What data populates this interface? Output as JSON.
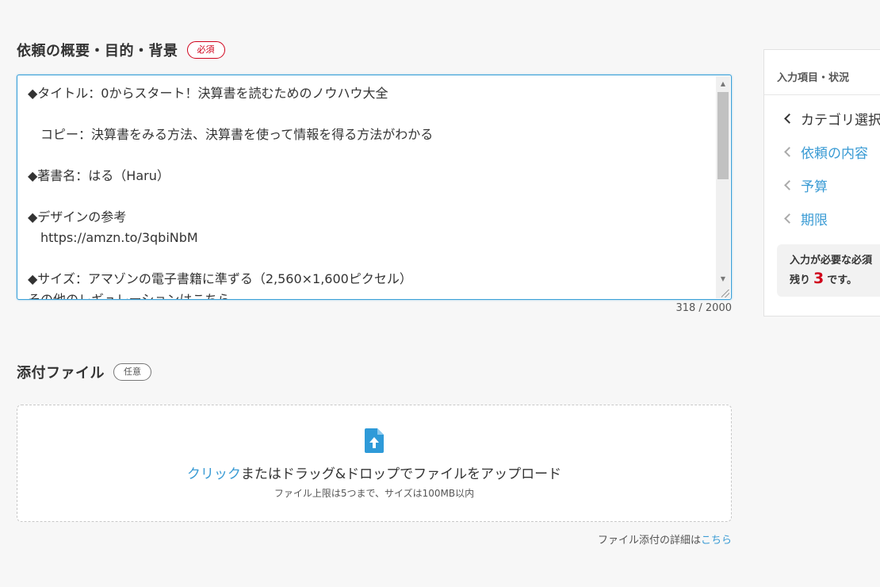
{
  "request_section": {
    "heading": "依頼の概要・目的・背景",
    "badge": "必須",
    "textarea_lines": [
      {
        "text": "◆タイトル：0からスタート！決算書を読むためのノウハウ大全",
        "indent": false
      },
      {
        "text": "",
        "indent": false
      },
      {
        "text": "コピー：決算書をみる方法、決算書を使って情報を得る方法がわかる",
        "indent": true
      },
      {
        "text": "",
        "indent": false
      },
      {
        "text": "◆著書名：はる（Haru）",
        "indent": false
      },
      {
        "text": "",
        "indent": false
      },
      {
        "text": "◆デザインの参考",
        "indent": false
      },
      {
        "text": "https://amzn.to/3qbiNbM",
        "indent": true
      },
      {
        "text": "",
        "indent": false
      },
      {
        "text": "◆サイズ：アマゾンの電子書籍に準ずる（2,560×1,600ピクセル）",
        "indent": false
      },
      {
        "text": "その他のレギュレーションはこちら",
        "indent": false
      }
    ],
    "char_count": "318 / 2000"
  },
  "attachment_section": {
    "heading": "添付ファイル",
    "badge": "任意",
    "dropzone_link": "クリック",
    "dropzone_text": "またはドラッグ&ドロップでファイルをアップロード",
    "dropzone_sub": "ファイル上限は5つまで、サイズは100MB以内",
    "note_prefix": "ファイル添付の詳細は",
    "note_link": "こちら",
    "upload_icon": "file-upload-icon"
  },
  "side_panel": {
    "title": "入力項目・状況",
    "items": [
      {
        "label": "カテゴリ選択",
        "state": "current"
      },
      {
        "label": "依頼の内容",
        "state": "todo"
      },
      {
        "label": "予算",
        "state": "todo"
      },
      {
        "label": "期限",
        "state": "todo"
      }
    ],
    "notice_line1": "入力が必要な必須",
    "notice_remaining_prefix": "残り",
    "notice_remaining_count": "3",
    "notice_remaining_suffix": "です。"
  },
  "colors": {
    "accent": "#3a9bd4",
    "required": "#d0021b",
    "background": "#f7f7f7"
  }
}
